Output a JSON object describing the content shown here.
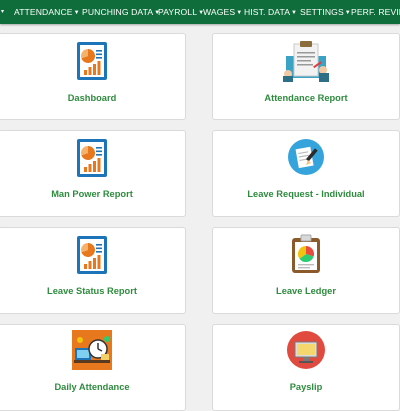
{
  "nav": {
    "items": [
      {
        "label": "ATTENDANCE"
      },
      {
        "label": "PUNCHING DATA"
      },
      {
        "label": "PAYROLL"
      },
      {
        "label": "WAGES"
      },
      {
        "label": "HIST. DATA"
      },
      {
        "label": "SETTINGS"
      },
      {
        "label": "PERF. REVIEW"
      }
    ]
  },
  "cards": [
    {
      "label": "Dashboard",
      "icon": "report-chart-icon"
    },
    {
      "label": "Attendance Report",
      "icon": "clipboard-signing-icon"
    },
    {
      "label": "Man Power Report",
      "icon": "report-chart-icon"
    },
    {
      "label": "Leave Request - Individual",
      "icon": "pen-paper-icon"
    },
    {
      "label": "Leave Status Report",
      "icon": "report-chart-icon"
    },
    {
      "label": "Leave Ledger",
      "icon": "clipboard-chart-icon"
    },
    {
      "label": "Daily Attendance",
      "icon": "desk-clock-icon"
    },
    {
      "label": "Payslip",
      "icon": "monitor-icon"
    }
  ],
  "colors": {
    "nav_bg": "#0e6d3a",
    "label_green": "#2e8b3e",
    "icon_blue": "#1e74b8",
    "icon_orange": "#e8781e",
    "page_bg": "#f0f0f0"
  }
}
